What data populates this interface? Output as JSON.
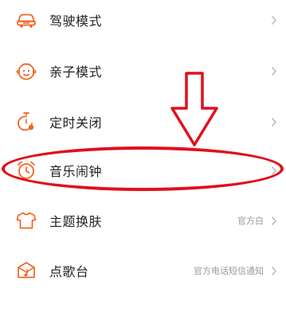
{
  "menu": {
    "items": [
      {
        "label": "驾驶模式",
        "value": "",
        "icon": "car-icon"
      },
      {
        "label": "亲子模式",
        "value": "",
        "icon": "child-face-icon"
      },
      {
        "label": "定时关闭",
        "value": "",
        "icon": "timer-icon"
      },
      {
        "label": "音乐闹钟",
        "value": "",
        "icon": "alarm-clock-icon"
      },
      {
        "label": "主题换肤",
        "value": "官方白",
        "icon": "tshirt-icon"
      },
      {
        "label": "点歌台",
        "value": "官方电话短信通知",
        "icon": "song-request-icon"
      }
    ]
  },
  "annotation": {
    "highlighted_item": "音乐闹钟",
    "arrow_direction": "down"
  },
  "colors": {
    "icon_accent": "#f26522",
    "label_text": "#222222",
    "value_text": "#9a9a9a",
    "chevron": "#b5b5b5",
    "annotation_red": "#e0101c"
  }
}
